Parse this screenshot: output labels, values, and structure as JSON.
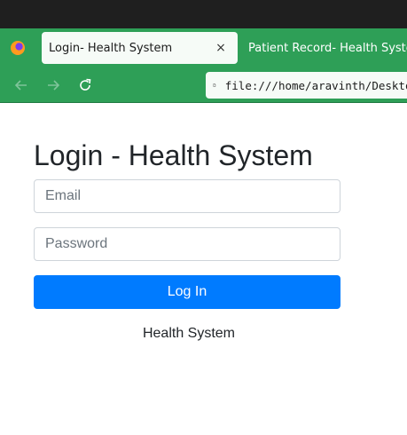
{
  "browser": {
    "tabs": [
      {
        "label": "Login- Health System",
        "active": true
      },
      {
        "label": "Patient Record- Health System",
        "active": false
      }
    ],
    "tab_close_glyph": "×",
    "url": "file:///home/aravinth/Desktop",
    "icons": [
      "firefox-icon",
      "back-arrow-icon",
      "forward-arrow-icon",
      "reload-icon",
      "page-icon",
      "close-icon"
    ],
    "colors": {
      "toolbar": "#2e9f57",
      "titlebar": "#1f1f1f"
    }
  },
  "page": {
    "heading": "Login - Health System",
    "email_placeholder": "Email",
    "password_placeholder": "Password",
    "login_label": "Log In",
    "footer": "Health System",
    "colors": {
      "primary_button": "#007bff"
    }
  }
}
